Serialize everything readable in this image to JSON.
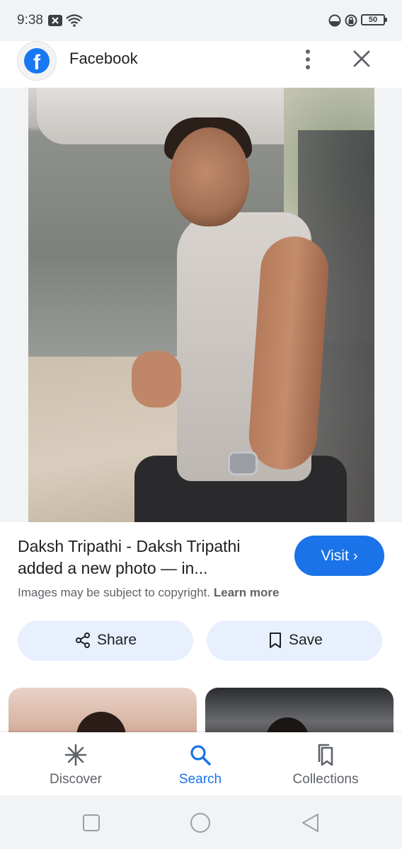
{
  "status_bar": {
    "time": "9:38",
    "battery": "50",
    "icons": [
      "notification-x-icon",
      "wifi-question-icon",
      "data-saver-icon",
      "vpn-lock-icon",
      "battery-icon"
    ]
  },
  "source": {
    "name": "Facebook",
    "logo_letter": "f",
    "brand_color": "#1877f2",
    "icons": [
      "facebook-logo-icon",
      "more-vert-icon",
      "close-icon"
    ]
  },
  "result": {
    "title": "Daksh Tripathi - Daksh Tripathi added a new photo — in...",
    "visit_label": "Visit",
    "copyright_text": "Images may be subject to copyright.",
    "learn_more_label": "Learn more"
  },
  "actions": {
    "share_label": "Share",
    "save_label": "Save"
  },
  "bottom_nav": {
    "items": [
      {
        "label": "Discover",
        "icon": "asterisk-icon",
        "active": false
      },
      {
        "label": "Search",
        "icon": "search-icon",
        "active": true
      },
      {
        "label": "Collections",
        "icon": "collections-icon",
        "active": false
      }
    ]
  },
  "system_nav": {
    "icons": [
      "recents-square-icon",
      "home-circle-icon",
      "back-triangle-icon"
    ]
  },
  "colors": {
    "accent": "#1a73e8",
    "button_tint": "#e8f0fe",
    "text_primary": "#202124",
    "text_secondary": "#5f6368"
  }
}
